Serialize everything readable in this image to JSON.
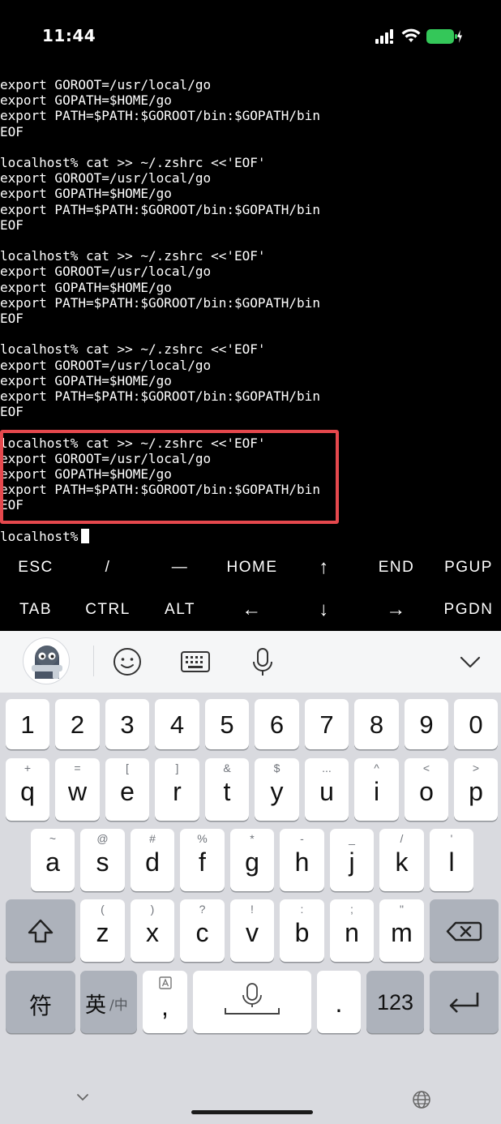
{
  "status_bar": {
    "time": "11:44",
    "battery_color": "#34c759"
  },
  "terminal": {
    "lines": [
      "export GOROOT=/usr/local/go",
      "export GOPATH=$HOME/go",
      "export PATH=$PATH:$GOROOT/bin:$GOPATH/bin",
      "EOF",
      "",
      "localhost% cat >> ~/.zshrc <<'EOF'",
      "export GOROOT=/usr/local/go",
      "export GOPATH=$HOME/go",
      "export PATH=$PATH:$GOROOT/bin:$GOPATH/bin",
      "EOF",
      "",
      "localhost% cat >> ~/.zshrc <<'EOF'",
      "export GOROOT=/usr/local/go",
      "export GOPATH=$HOME/go",
      "export PATH=$PATH:$GOROOT/bin:$GOPATH/bin",
      "EOF",
      "",
      "localhost% cat >> ~/.zshrc <<'EOF'",
      "export GOROOT=/usr/local/go",
      "export GOPATH=$HOME/go",
      "export PATH=$PATH:$GOROOT/bin:$GOPATH/bin",
      "EOF",
      "",
      "localhost% cat >> ~/.zshrc <<'EOF'",
      "export GOROOT=/usr/local/go",
      "export GOPATH=$HOME/go",
      "export PATH=$PATH:$GOROOT/bin:$GOPATH/bin",
      "EOF",
      ""
    ],
    "prompt": "localhost%",
    "highlight_color": "#e5484d"
  },
  "extra_keys": {
    "row1": [
      "ESC",
      "/",
      "—",
      "HOME",
      "↑",
      "END",
      "PGUP"
    ],
    "row2": [
      "TAB",
      "CTRL",
      "ALT",
      "←",
      "↓",
      "→",
      "PGDN"
    ]
  },
  "keyboard": {
    "toolbar_icons": [
      "mascot-avatar",
      "emoji-icon",
      "keyboard-icon",
      "microphone-icon",
      "chevron-down-icon"
    ],
    "numbers": [
      "1",
      "2",
      "3",
      "4",
      "5",
      "6",
      "7",
      "8",
      "9",
      "0"
    ],
    "row_q": [
      {
        "main": "q",
        "hint": "+"
      },
      {
        "main": "w",
        "hint": "="
      },
      {
        "main": "e",
        "hint": "["
      },
      {
        "main": "r",
        "hint": "]"
      },
      {
        "main": "t",
        "hint": "&"
      },
      {
        "main": "y",
        "hint": "$"
      },
      {
        "main": "u",
        "hint": "..."
      },
      {
        "main": "i",
        "hint": "^"
      },
      {
        "main": "o",
        "hint": "<"
      },
      {
        "main": "p",
        "hint": ">"
      }
    ],
    "row_a": [
      {
        "main": "a",
        "hint": "~"
      },
      {
        "main": "s",
        "hint": "@"
      },
      {
        "main": "d",
        "hint": "#"
      },
      {
        "main": "f",
        "hint": "%"
      },
      {
        "main": "g",
        "hint": "*"
      },
      {
        "main": "h",
        "hint": "-"
      },
      {
        "main": "j",
        "hint": "_"
      },
      {
        "main": "k",
        "hint": "/"
      },
      {
        "main": "l",
        "hint": "'"
      }
    ],
    "row_z": [
      {
        "main": "z",
        "hint": "("
      },
      {
        "main": "x",
        "hint": ")"
      },
      {
        "main": "c",
        "hint": "?"
      },
      {
        "main": "v",
        "hint": "!"
      },
      {
        "main": "b",
        "hint": ":"
      },
      {
        "main": "n",
        "hint": ";"
      },
      {
        "main": "m",
        "hint": "\""
      }
    ],
    "symbols_key": "符",
    "lang_key_main": "英",
    "lang_key_alt": "/中",
    "comma_key": ",",
    "period_key": ".",
    "numbers_key": "123"
  }
}
